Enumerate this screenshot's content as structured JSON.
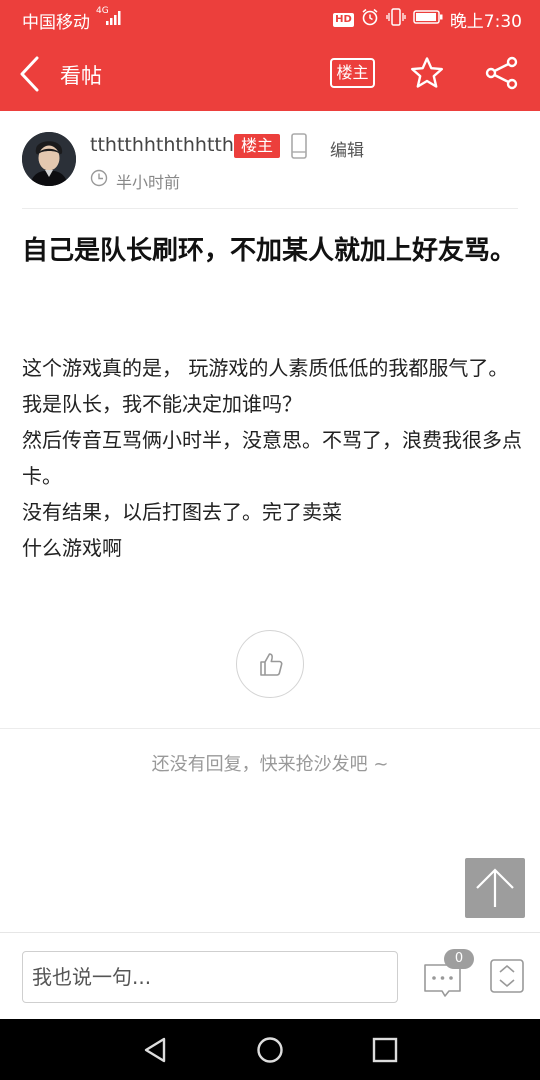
{
  "status_bar": {
    "carrier": "中国移动",
    "network": "4G",
    "hd": "HD",
    "time": "晚上7:30"
  },
  "header": {
    "title": "看帖",
    "owner_only_label": "楼主",
    "back_icon": "chevron-left-icon",
    "star_icon": "star-icon",
    "share_icon": "share-icon"
  },
  "author": {
    "name": "tthtthhththhtth",
    "badge": "楼主",
    "edit_label": "编辑",
    "time": "半小时前"
  },
  "post": {
    "title": "自己是队长刷环，不加某人就加上好友骂。",
    "body_lines": [
      "这个游戏真的是， 玩游戏的人素质低低的我都服气了。",
      "我是队长，我不能决定加谁吗？",
      "然后传音互骂俩小时半，没意思。不骂了，浪费我很多点卡。",
      "没有结果，以后打图去了。完了卖菜",
      "什么游戏啊"
    ]
  },
  "replies": {
    "empty_text": "还没有回复，快来抢沙发吧 ~"
  },
  "bottom_bar": {
    "input_placeholder": "我也说一句...",
    "comment_count": "0"
  },
  "colors": {
    "brand_red": "#ec3f3c",
    "badge_gray": "#9e9e9e"
  }
}
